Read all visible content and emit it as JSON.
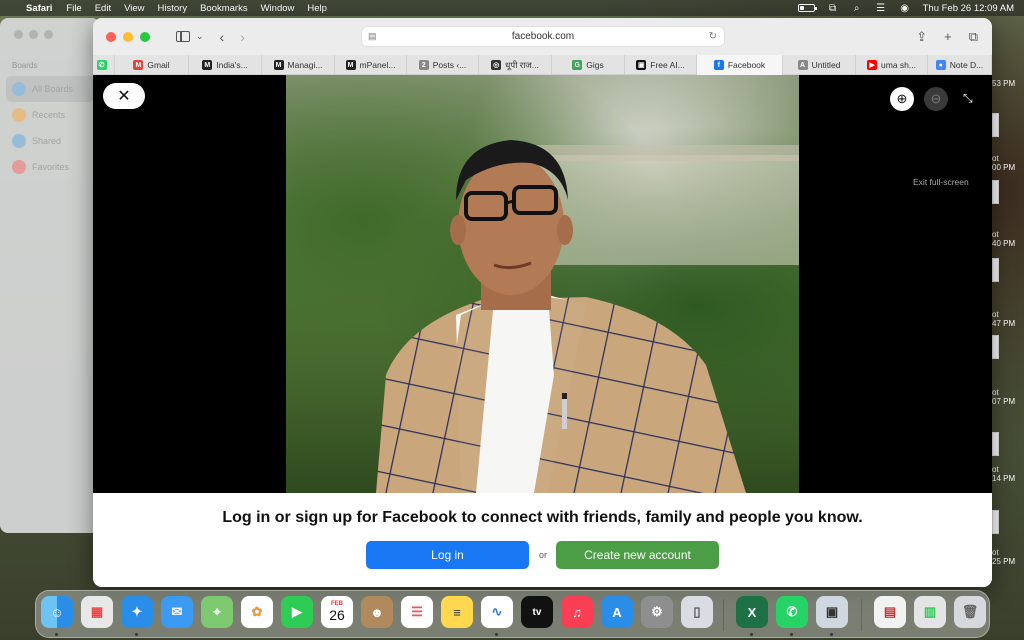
{
  "menubar": {
    "app": "Safari",
    "items": [
      "File",
      "Edit",
      "View",
      "History",
      "Bookmarks",
      "Window",
      "Help"
    ],
    "datetime": "Thu Feb 26  12:09 AM"
  },
  "background_window": {
    "section": "Boards",
    "items": [
      "All Boards",
      "Recents",
      "Shared",
      "Favorites"
    ]
  },
  "desktop_strip": [
    {
      "a": "ot",
      "b": "53 PM"
    },
    {
      "a": "ot",
      "b": "00 PM"
    },
    {
      "a": "ot",
      "b": "40 PM"
    },
    {
      "a": "ot",
      "b": "47 PM"
    },
    {
      "a": "ot",
      "b": "07 PM"
    },
    {
      "a": "ot",
      "b": "14 PM"
    },
    {
      "a": "ot",
      "b": "25 PM"
    }
  ],
  "browser": {
    "url": "facebook.com",
    "tabs": [
      {
        "label": "",
        "icon": "whatsapp-icon",
        "color": "#25d366",
        "glyph": "✆"
      },
      {
        "label": "Gmail",
        "icon": "gmail-icon",
        "color": "#ea4335",
        "glyph": "M"
      },
      {
        "label": "India's...",
        "icon": "m-icon",
        "color": "#222222",
        "glyph": "M"
      },
      {
        "label": "Managi...",
        "icon": "m-icon",
        "color": "#222222",
        "glyph": "M"
      },
      {
        "label": "mPanel...",
        "icon": "m-icon",
        "color": "#222222",
        "glyph": "M"
      },
      {
        "label": "Posts ‹...",
        "icon": "number-icon",
        "color": "#888888",
        "glyph": "2"
      },
      {
        "label": "धूपी राज...",
        "icon": "github-icon",
        "color": "#333333",
        "glyph": "◎"
      },
      {
        "label": "Gigs",
        "icon": "gigs-icon",
        "color": "#3aa757",
        "glyph": "G"
      },
      {
        "label": "Free AI...",
        "icon": "square-icon",
        "color": "#111111",
        "glyph": "▣"
      },
      {
        "label": "Facebook",
        "icon": "facebook-icon",
        "color": "#1877f2",
        "glyph": "f"
      },
      {
        "label": "Untitled",
        "icon": "a-icon",
        "color": "#888888",
        "glyph": "A"
      },
      {
        "label": "uma sh...",
        "icon": "youtube-icon",
        "color": "#ff0000",
        "glyph": "▶"
      },
      {
        "label": "Note D...",
        "icon": "note-icon",
        "color": "#4285f4",
        "glyph": "●"
      }
    ],
    "active_tab_index": 9
  },
  "viewer": {
    "close_symbol": "✕",
    "exit_tooltip": "Exit full-screen"
  },
  "cta": {
    "message": "Log in or sign up for Facebook to connect with friends, family and people you know.",
    "login_label": "Log in",
    "or_label": "or",
    "create_label": "Create new account"
  },
  "calendar": {
    "month": "FEB",
    "day": "26"
  }
}
